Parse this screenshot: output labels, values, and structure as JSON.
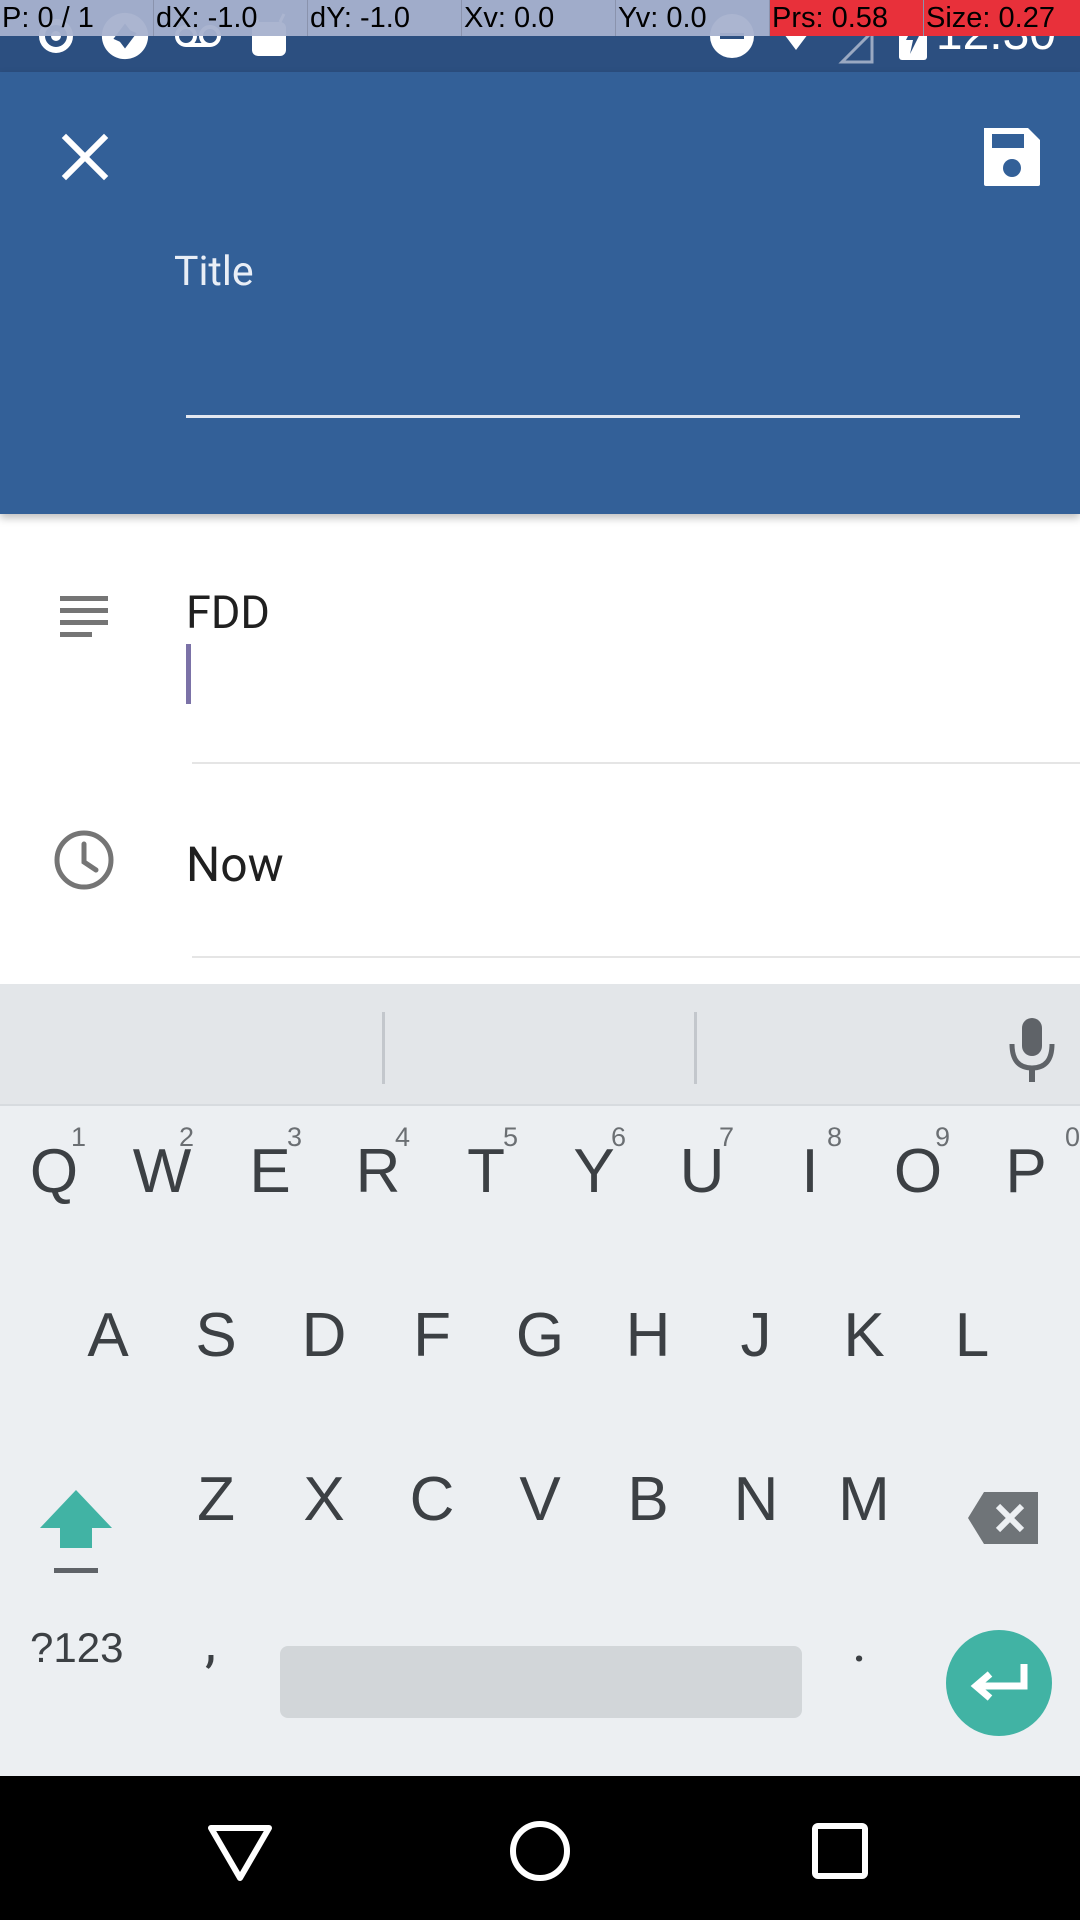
{
  "pointer_overlay": {
    "cells": [
      "P: 0 / 1",
      "dX: -1.0",
      "dY: -1.0",
      "Xv: 0.0",
      "Yv: 0.0",
      "Prs: 0.58",
      "Size: 0.27"
    ]
  },
  "status_bar": {
    "time": "12:30"
  },
  "app_bar": {
    "title_label": "Title",
    "title_value": ""
  },
  "description": {
    "text": "FDD"
  },
  "when": {
    "text": "Now"
  },
  "keyboard": {
    "row1": [
      {
        "letter": "Q",
        "num": "1"
      },
      {
        "letter": "W",
        "num": "2"
      },
      {
        "letter": "E",
        "num": "3"
      },
      {
        "letter": "R",
        "num": "4"
      },
      {
        "letter": "T",
        "num": "5"
      },
      {
        "letter": "Y",
        "num": "6"
      },
      {
        "letter": "U",
        "num": "7"
      },
      {
        "letter": "I",
        "num": "8"
      },
      {
        "letter": "O",
        "num": "9"
      },
      {
        "letter": "P",
        "num": "0"
      }
    ],
    "row2": [
      "A",
      "S",
      "D",
      "F",
      "G",
      "H",
      "J",
      "K",
      "L"
    ],
    "row3": [
      "Z",
      "X",
      "C",
      "V",
      "B",
      "N",
      "M"
    ],
    "symbols_label": "?123",
    "comma": ",",
    "period": "."
  },
  "colors": {
    "app_bar": "#336098",
    "status_bar": "#2c4f80",
    "enter_key": "#41b3a4",
    "cursor": "#7b72a7"
  }
}
